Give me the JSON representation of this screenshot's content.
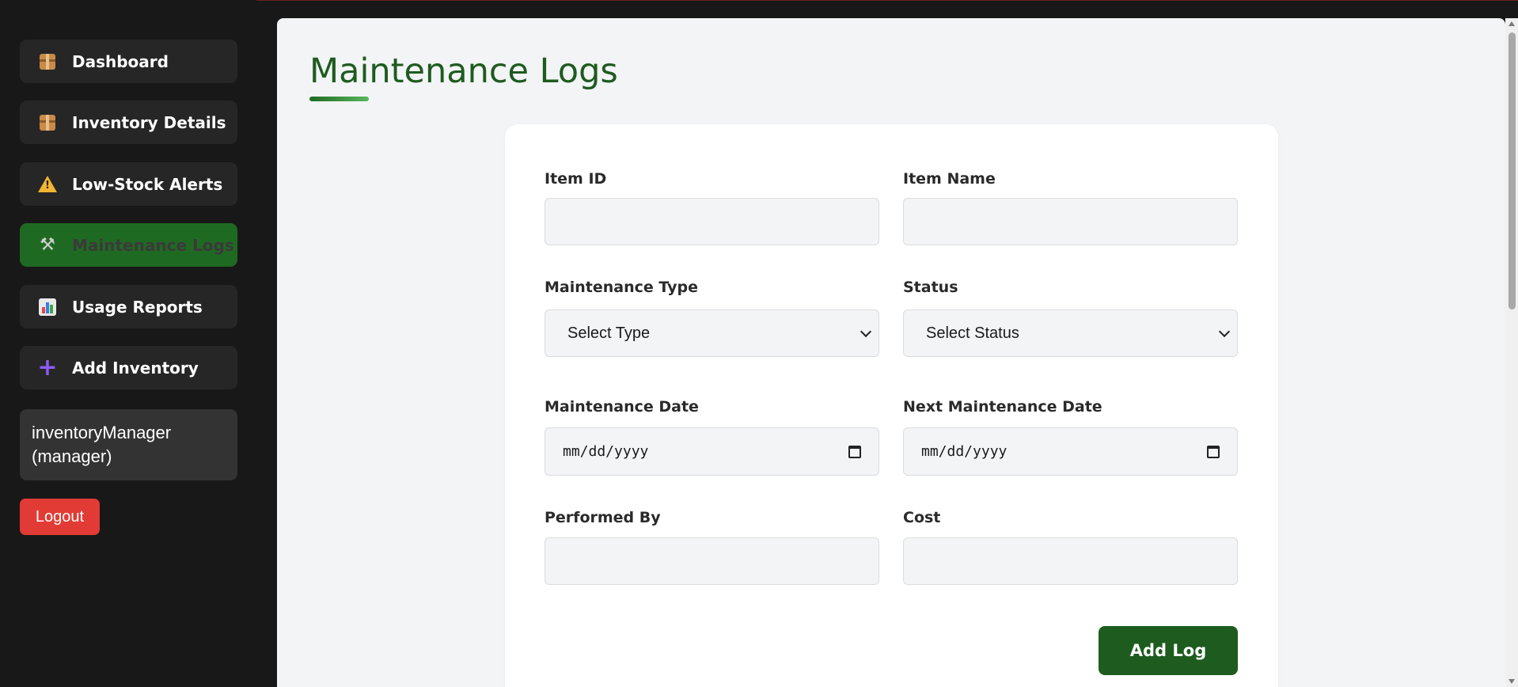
{
  "sidebar": {
    "items": [
      {
        "label": "Dashboard",
        "icon": "package-icon"
      },
      {
        "label": "Inventory Details",
        "icon": "package-icon"
      },
      {
        "label": "Low-Stock Alerts",
        "icon": "warning-icon"
      },
      {
        "label": "Maintenance Logs",
        "icon": "tools-icon",
        "active": true
      },
      {
        "label": "Usage Reports",
        "icon": "bar-chart-icon"
      },
      {
        "label": "Add Inventory",
        "icon": "plus-icon"
      }
    ],
    "user": "inventoryManager (manager)",
    "logout_label": "Logout"
  },
  "main": {
    "title": "Maintenance Logs",
    "form": {
      "item_id_label": "Item ID",
      "item_id_value": "",
      "item_name_label": "Item Name",
      "item_name_value": "",
      "maintenance_type_label": "Maintenance Type",
      "maintenance_type_value": "Select Type",
      "status_label": "Status",
      "status_value": "Select Status",
      "maintenance_date_label": "Maintenance Date",
      "maintenance_date_value": "mm/dd/yyyy",
      "next_maintenance_date_label": "Next Maintenance Date",
      "next_maintenance_date_value": "mm/dd/yyyy",
      "performed_by_label": "Performed By",
      "performed_by_value": "",
      "cost_label": "Cost",
      "cost_value": "",
      "submit_label": "Add Log"
    }
  },
  "colors": {
    "sidebar_bg": "#181818",
    "nav_item_bg": "#262626",
    "active_green": "#1f6a22",
    "title_green": "#1e5b1f",
    "logout_red": "#e23b35",
    "panel_bg": "#f3f4f6"
  }
}
